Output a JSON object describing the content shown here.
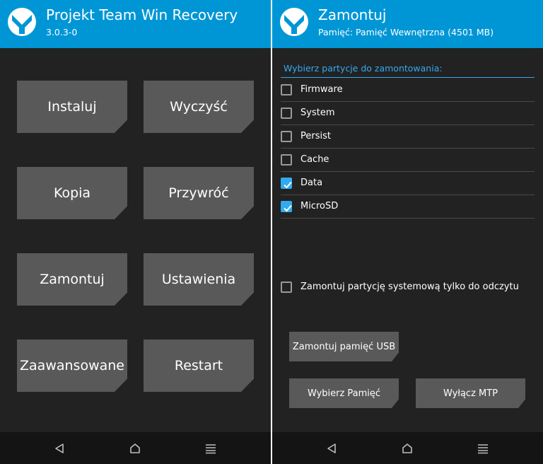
{
  "left": {
    "header": {
      "title": "Projekt Team Win Recovery",
      "subtitle": "3.0.3-0",
      "logo_icon": "twrp-logo-icon"
    },
    "menu": {
      "install_label": "Instaluj",
      "wipe_label": "Wyczyść",
      "backup_label": "Kopia",
      "restore_label": "Przywróć",
      "mount_label": "Zamontuj",
      "settings_label": "Ustawienia",
      "advanced_label": "Zaawansowane",
      "reboot_label": "Restart"
    },
    "nav": {
      "back_icon": "back-icon",
      "home_icon": "home-icon",
      "menu_icon": "menu-icon"
    }
  },
  "right": {
    "header": {
      "title": "Zamontuj",
      "subtitle": "Pamięć: Pamięć Wewnętrzna (4501 MB)",
      "logo_icon": "twrp-logo-icon"
    },
    "section_label": "Wybierz partycje do zamontowania:",
    "partitions": [
      {
        "label": "Firmware",
        "checked": false
      },
      {
        "label": "System",
        "checked": false
      },
      {
        "label": "Persist",
        "checked": false
      },
      {
        "label": "Cache",
        "checked": false
      },
      {
        "label": "Data",
        "checked": true
      },
      {
        "label": "MicroSD",
        "checked": true
      }
    ],
    "readonly_option": {
      "label": "Zamontuj partycję systemową tylko do odczytu",
      "checked": false
    },
    "buttons": {
      "mount_usb_label": "Zamontuj pamięć USB",
      "select_storage_label": "Wybierz Pamięć",
      "disable_mtp_label": "Wyłącz MTP"
    },
    "nav": {
      "back_icon": "back-icon",
      "home_icon": "home-icon",
      "menu_icon": "menu-icon"
    }
  },
  "colors": {
    "accent": "#0096d6",
    "checkbox_accent": "#33aaee",
    "background": "#222222",
    "tile": "#595959",
    "nav_bar": "#141414"
  }
}
